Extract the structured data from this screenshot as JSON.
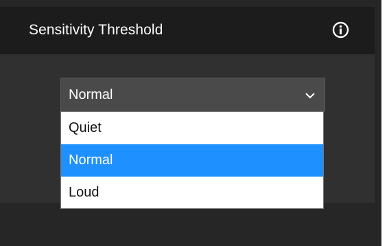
{
  "panel": {
    "title": "Sensitivity Threshold",
    "info_icon": "info-icon"
  },
  "select": {
    "value": "Normal",
    "chevron_icon": "chevron-down-icon",
    "options": [
      {
        "label": "Quiet",
        "selected": false
      },
      {
        "label": "Normal",
        "selected": true
      },
      {
        "label": "Loud",
        "selected": false
      }
    ]
  },
  "colors": {
    "panel_background": "#303030",
    "header_background": "#1c1c1c",
    "select_background": "#4a4a4a",
    "highlight": "#1e90ff",
    "text_light": "#ffffff",
    "text_dark": "#111111"
  }
}
